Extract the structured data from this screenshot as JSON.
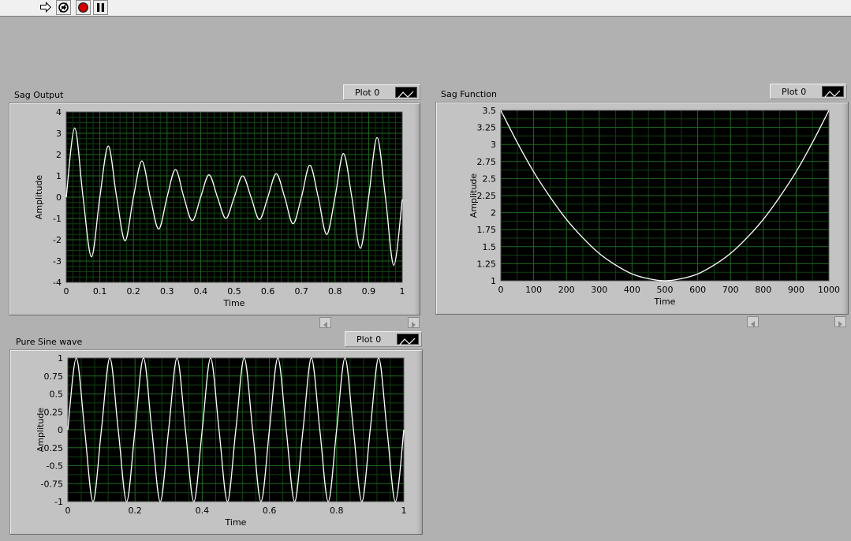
{
  "toolbar": {
    "run_icon": "run-arrow-icon",
    "run_continuously_icon": "run-continuously-icon",
    "abort_icon": "abort-execution-icon",
    "pause_icon": "pause-icon"
  },
  "colors": {
    "background": "#b1b1b1",
    "plot_area": "#000000",
    "grid": "#1f6a1f",
    "trace": "#ffffff",
    "abort_red": "#d40000"
  },
  "graphs": [
    {
      "label": "Sag Output",
      "legend_label": "Plot 0",
      "chart_data": {
        "type": "line",
        "xlabel": "Time",
        "ylabel": "Amplitude",
        "xlim": [
          0,
          1
        ],
        "ylim": [
          -4,
          4
        ],
        "x_ticks": [
          "0",
          "0.1",
          "0.2",
          "0.3",
          "0.4",
          "0.5",
          "0.6",
          "0.7",
          "0.8",
          "0.9",
          "1"
        ],
        "y_ticks": [
          "4",
          "3",
          "2",
          "1",
          "0",
          "-1",
          "-2",
          "-3",
          "-4"
        ],
        "grid": true,
        "series": [
          {
            "x": [
              0,
              0.025,
              0.05,
              0.075,
              0.1,
              0.125,
              0.15,
              0.175,
              0.2,
              0.225,
              0.25,
              0.275,
              0.3,
              0.325,
              0.35,
              0.375,
              0.4,
              0.425,
              0.45,
              0.475,
              0.5,
              0.525,
              0.55,
              0.575,
              0.6,
              0.625,
              0.65,
              0.675,
              0.7,
              0.725,
              0.75,
              0.775,
              0.8,
              0.825,
              0.85,
              0.875,
              0.9,
              0.925,
              0.95,
              0.975,
              1
            ],
            "y": [
              0,
              3.25,
              0,
              -2.8,
              0,
              2.4,
              0,
              -2.05,
              0,
              1.7,
              0,
              -1.5,
              0,
              1.3,
              0,
              -1.1,
              0,
              1.05,
              0,
              -1.0,
              0,
              1.0,
              0,
              -1.05,
              0,
              1.1,
              0,
              -1.25,
              0,
              1.5,
              0,
              -1.75,
              0,
              2.05,
              0,
              -2.4,
              0,
              2.8,
              0,
              -3.2,
              -0.1
            ]
          }
        ]
      }
    },
    {
      "label": "Sag Function",
      "legend_label": "Plot 0",
      "chart_data": {
        "type": "line",
        "xlabel": "Time",
        "ylabel": "Amplitude",
        "xlim": [
          0,
          1000
        ],
        "ylim": [
          1,
          3.5
        ],
        "x_ticks": [
          "0",
          "100",
          "200",
          "300",
          "400",
          "500",
          "600",
          "700",
          "800",
          "900",
          "1000"
        ],
        "y_ticks": [
          "3.5",
          "3.25",
          "3",
          "2.75",
          "2.5",
          "2.25",
          "2",
          "1.75",
          "1.5",
          "1.25",
          "1"
        ],
        "grid": true,
        "series": [
          {
            "x": [
              0,
              50,
              100,
              150,
              200,
              250,
              300,
              350,
              400,
              450,
              500,
              550,
              600,
              650,
              700,
              750,
              800,
              850,
              900,
              950,
              1000
            ],
            "y": [
              3.5,
              3.03,
              2.6,
              2.23,
              1.9,
              1.63,
              1.4,
              1.23,
              1.1,
              1.03,
              1.0,
              1.03,
              1.1,
              1.23,
              1.4,
              1.63,
              1.9,
              2.23,
              2.6,
              3.03,
              3.5
            ]
          }
        ]
      }
    },
    {
      "label": "Pure Sine wave",
      "legend_label": "Plot 0",
      "chart_data": {
        "type": "line",
        "xlabel": "Time",
        "ylabel": "Amplitude",
        "xlim": [
          0,
          1
        ],
        "ylim": [
          -1,
          1
        ],
        "x_ticks": [
          "0",
          "0.2",
          "0.4",
          "0.6",
          "0.8",
          "1"
        ],
        "y_ticks": [
          "1",
          "0.75",
          "0.5",
          "0.25",
          "0",
          "-0.25",
          "-0.5",
          "-0.75",
          "-1"
        ],
        "grid": true,
        "series": [
          {
            "x": [
              0,
              0.025,
              0.05,
              0.075,
              0.1,
              0.125,
              0.15,
              0.175,
              0.2,
              0.225,
              0.25,
              0.275,
              0.3,
              0.325,
              0.35,
              0.375,
              0.4,
              0.425,
              0.45,
              0.475,
              0.5,
              0.525,
              0.55,
              0.575,
              0.6,
              0.625,
              0.65,
              0.675,
              0.7,
              0.725,
              0.75,
              0.775,
              0.8,
              0.825,
              0.85,
              0.875,
              0.9,
              0.925,
              0.95,
              0.975,
              1
            ],
            "y": [
              0,
              1,
              0,
              -1,
              0,
              1,
              0,
              -1,
              0,
              1,
              0,
              -1,
              0,
              1,
              0,
              -1,
              0,
              1,
              0,
              -1,
              0,
              1,
              0,
              -1,
              0,
              1,
              0,
              -1,
              0,
              1,
              0,
              -1,
              0,
              1,
              0,
              -1,
              0,
              1,
              0,
              -1,
              0
            ]
          }
        ]
      }
    }
  ]
}
